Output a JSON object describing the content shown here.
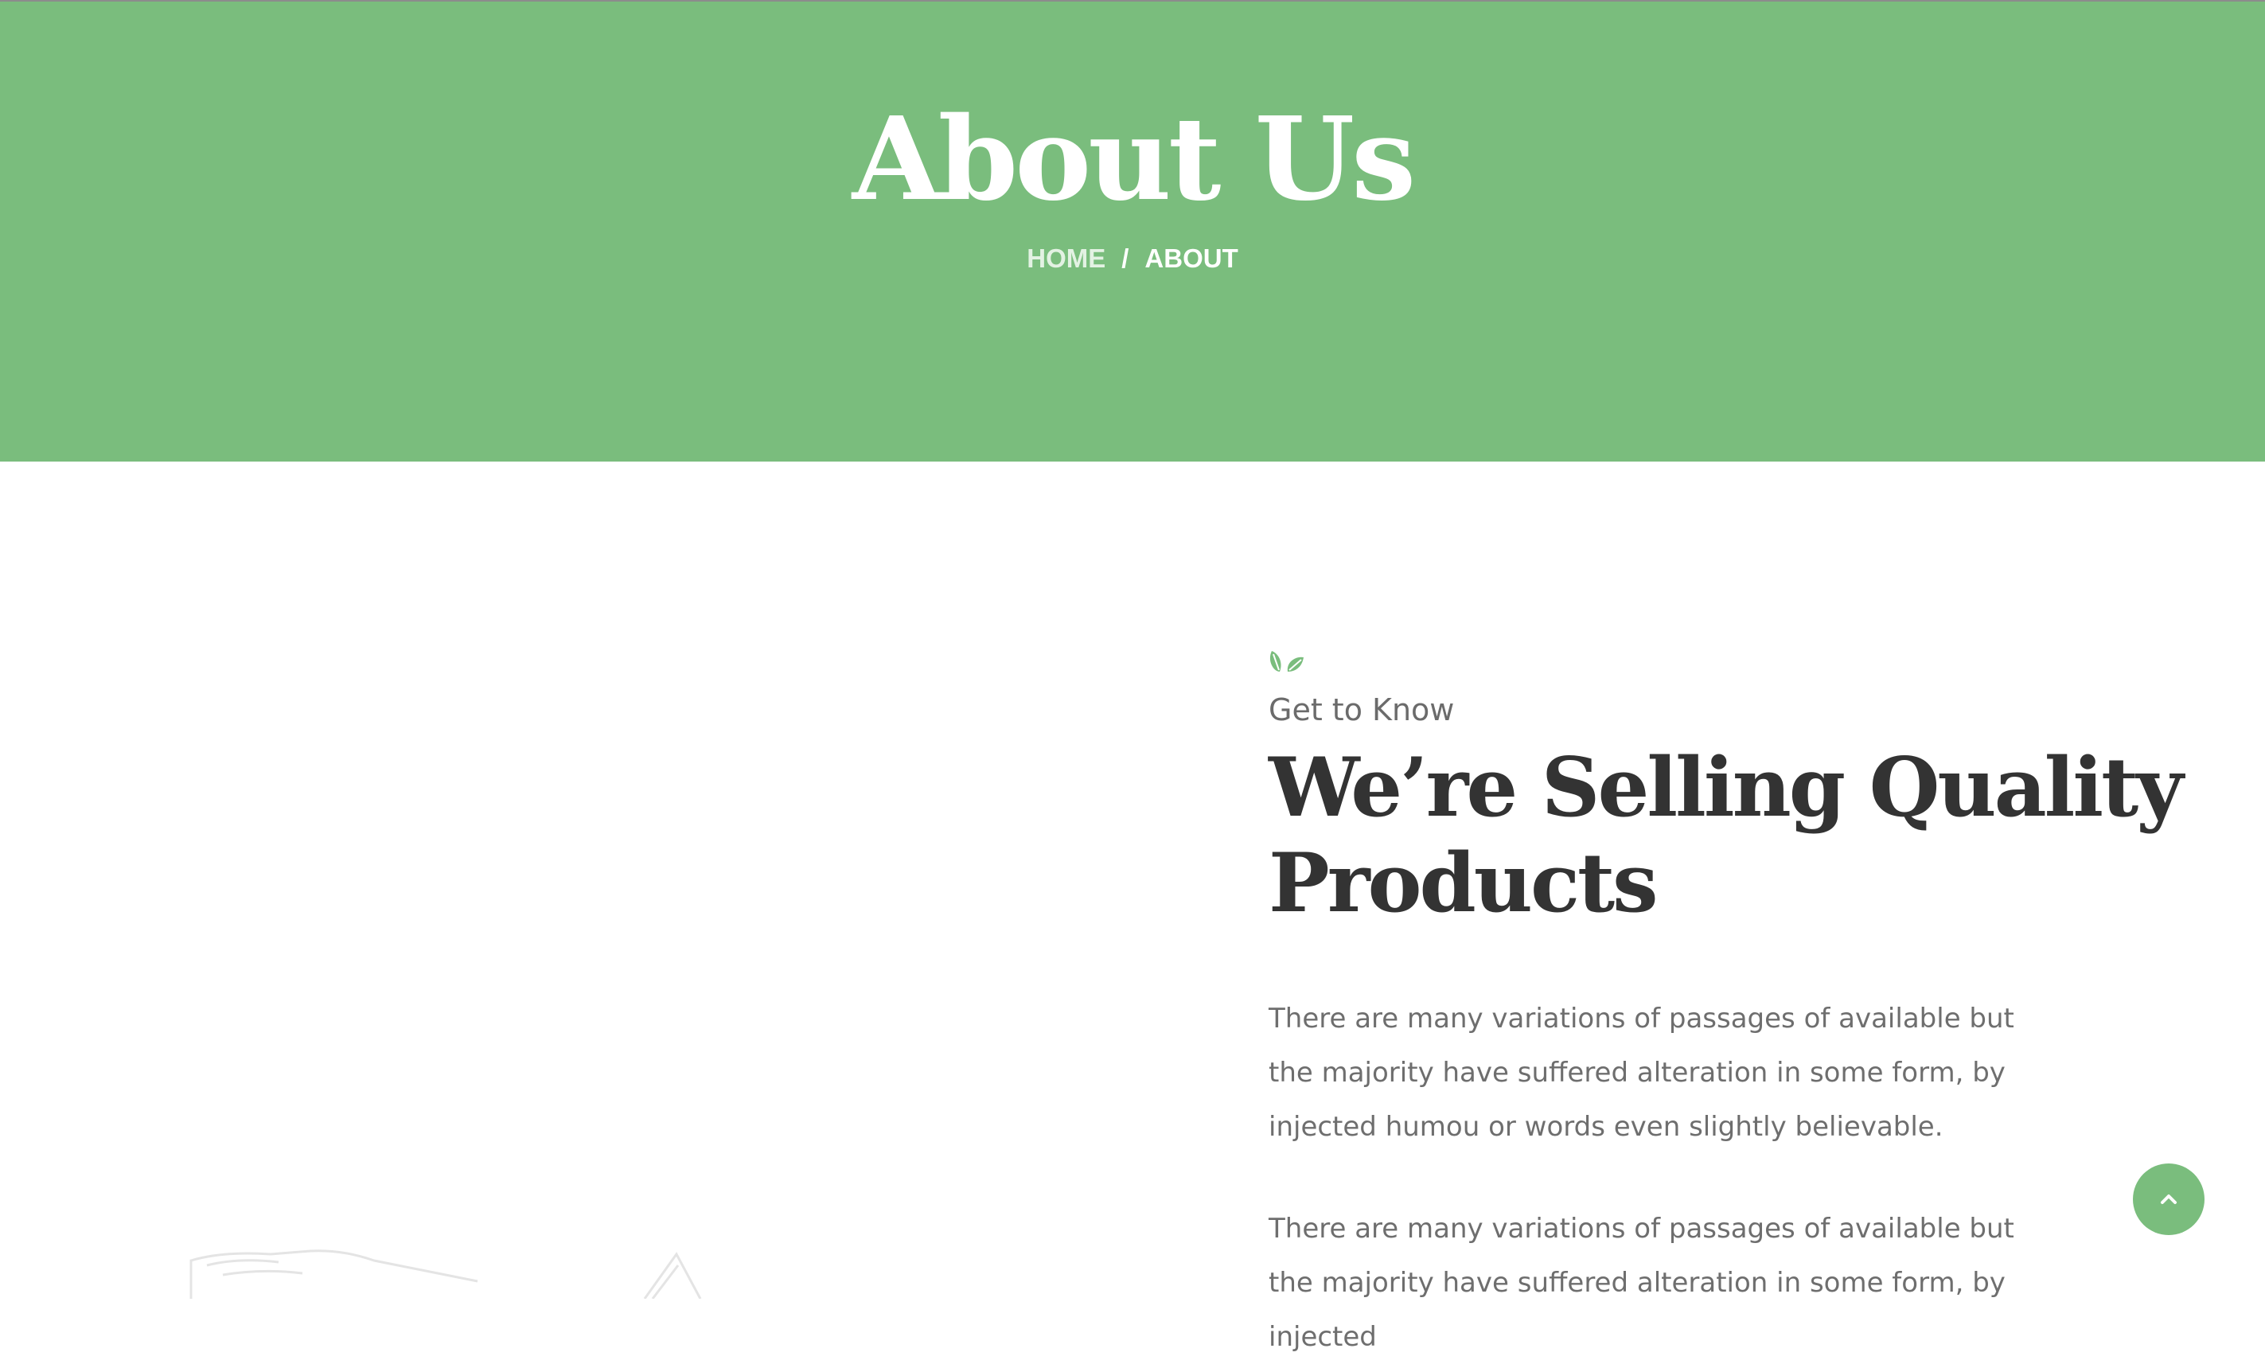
{
  "hero": {
    "title": "About Us",
    "breadcrumb": {
      "home": "HOME",
      "separator": "/",
      "current": "ABOUT"
    }
  },
  "about": {
    "eyebrow": "Get to Know",
    "headline": "We’re Selling Quality Products",
    "paragraphs": [
      "There are many variations of passages of available but the majority have suffered alteration in some form, by injected humou or words even slightly believable.",
      "There are many variations of passages of available but the majority have suffered alteration in some form, by injected"
    ]
  },
  "icons": {
    "eyebrow_icon": "leaf-icon",
    "back_to_top_icon": "chevron-up-icon"
  },
  "colors": {
    "brand_green": "#7abd7d",
    "heading_dark": "#333333",
    "body_text": "#6e6e6e"
  }
}
